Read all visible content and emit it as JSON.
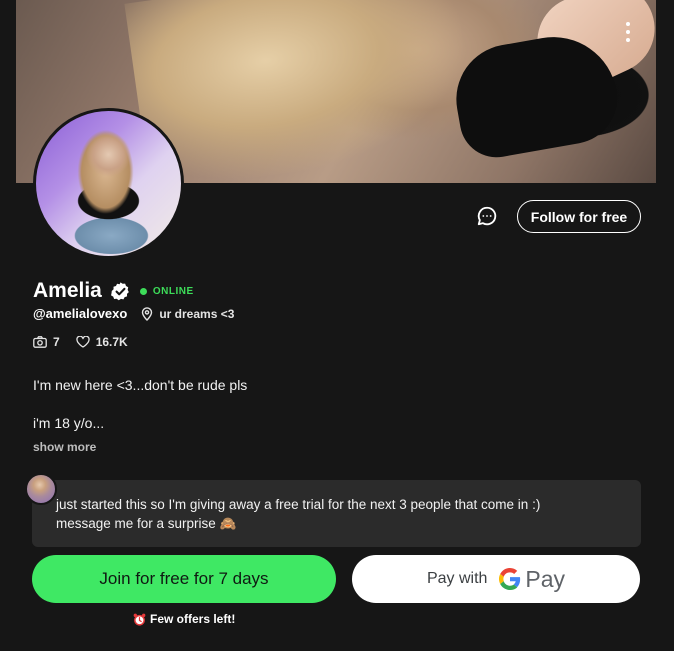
{
  "profile": {
    "name": "Amelia",
    "status": "ONLINE",
    "handle": "@amelialovexo",
    "location": "ur dreams <3",
    "stats": {
      "media_count": "7",
      "likes": "16.7K"
    },
    "bio_lines": [
      "I'm new here <3...don't be rude pls",
      "i'm 18 y/o..."
    ],
    "show_more": "show more"
  },
  "actions": {
    "follow_label": "Follow for free"
  },
  "message": {
    "line1": "just started this so I'm giving away a free trial for the next 3 people that come in :)",
    "line2": "message me for a surprise 🙈"
  },
  "cta": {
    "join_label": "Join for free for 7 days",
    "gpay_prefix": "Pay with",
    "gpay_word": "Pay",
    "few_offers": "Few offers left!"
  },
  "colors": {
    "accent_green": "#3fe864",
    "online_green": "#3ddc59",
    "background": "#161616"
  },
  "icons": [
    "more-vertical-icon",
    "chat-bubble-icon",
    "verified-badge-icon",
    "location-pin-icon",
    "camera-icon",
    "heart-icon",
    "google-g-icon",
    "alarm-clock-icon"
  ]
}
